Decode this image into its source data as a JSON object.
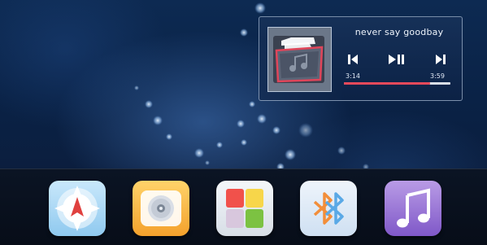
{
  "music_widget": {
    "song_title": "never say goodbay",
    "time_elapsed": "3:14",
    "time_total": "3:59",
    "progress_fraction": 0.811,
    "controls": [
      "previous",
      "play-pause",
      "next"
    ],
    "colors": {
      "progress_fill": "#e8495a",
      "progress_track": "#d9dee6",
      "album_border": "#e0455a"
    }
  },
  "dock": {
    "apps": [
      {
        "id": "navigation",
        "icon": "compass-icon"
      },
      {
        "id": "media",
        "icon": "disc-icon"
      },
      {
        "id": "gallery",
        "icon": "gallery-icon"
      },
      {
        "id": "bluetooth",
        "icon": "bluetooth-icon"
      },
      {
        "id": "music",
        "icon": "music-note-icon"
      }
    ]
  }
}
